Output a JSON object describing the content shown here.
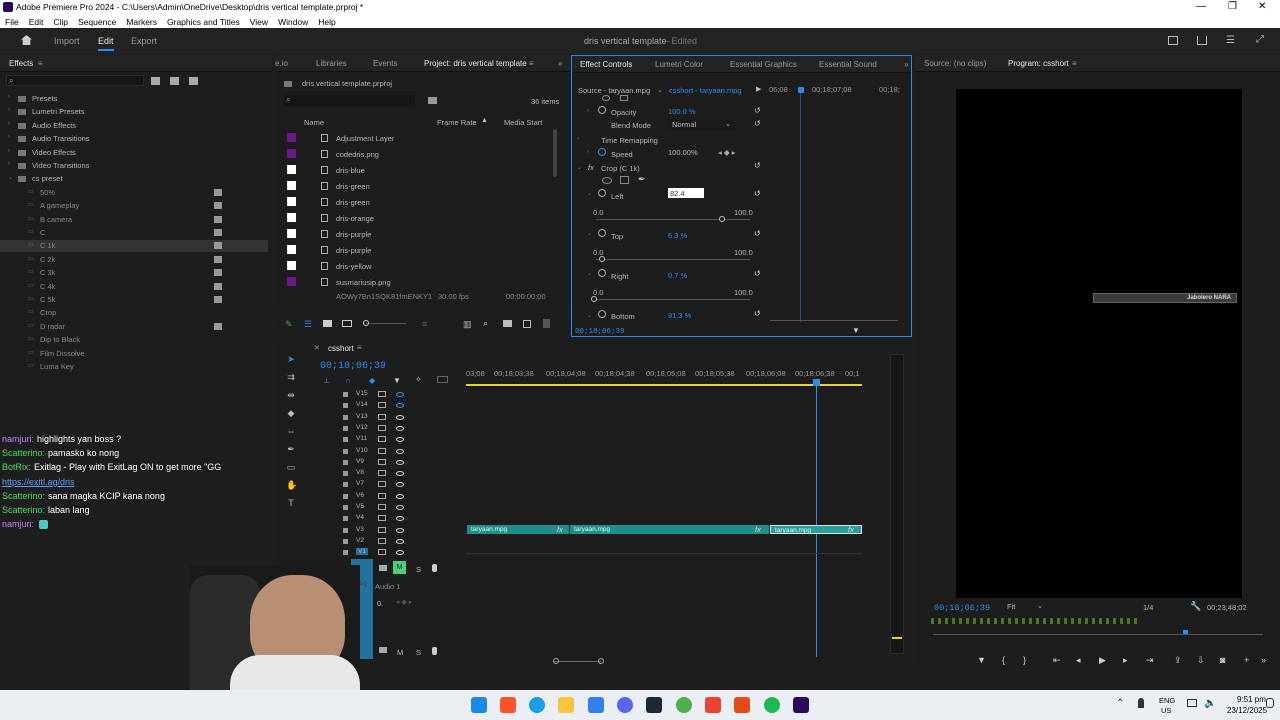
{
  "app": {
    "title": "Adobe Premiere Pro 2024 - C:\\Users\\Admin\\OneDrive\\Desktop\\dris vertical template.prproj *",
    "window_controls": [
      "—",
      "❐",
      "✕"
    ]
  },
  "menu": [
    "File",
    "Edit",
    "Clip",
    "Sequence",
    "Markers",
    "Graphics and Titles",
    "View",
    "Window",
    "Help"
  ],
  "workspaces": {
    "import": "Import",
    "edit": "Edit",
    "export": "Export",
    "project_title": "dris vertical template",
    "edited": "- Edited"
  },
  "effects_panel": {
    "title": "Effects",
    "items": [
      {
        "label": "Presets",
        "indent": 0
      },
      {
        "label": "Lumetri Presets",
        "indent": 0
      },
      {
        "label": "Audio Effects",
        "indent": 0
      },
      {
        "label": "Audio Transitions",
        "indent": 0
      },
      {
        "label": "Video Effects",
        "indent": 0
      },
      {
        "label": "Video Transitions",
        "indent": 0
      },
      {
        "label": "cs preset",
        "indent": 0
      },
      {
        "label": "50%",
        "indent": 1
      },
      {
        "label": "A gameplay",
        "indent": 1
      },
      {
        "label": "B camera",
        "indent": 1
      },
      {
        "label": "C",
        "indent": 1
      },
      {
        "label": "C 1k",
        "indent": 1
      },
      {
        "label": "C 2k",
        "indent": 1
      },
      {
        "label": "C 3k",
        "indent": 1
      },
      {
        "label": "C 4k",
        "indent": 1
      },
      {
        "label": "C 5k",
        "indent": 1
      },
      {
        "label": "Crop",
        "indent": 1
      },
      {
        "label": "D radar",
        "indent": 1
      },
      {
        "label": "Dip to Black",
        "indent": 1
      },
      {
        "label": "Film Dissolve",
        "indent": 1
      },
      {
        "label": "Luma Key",
        "indent": 1
      }
    ]
  },
  "project_panel": {
    "tabs": [
      "e.io",
      "Libraries",
      "Events",
      "Project: dris vertical template"
    ],
    "file": "dris vertical template.prproj",
    "item_count": "36 items",
    "col_name": "Name",
    "col_rate": "Frame Rate",
    "col_start": "Media Start",
    "items": [
      {
        "name": "Adjustment Layer",
        "color": "#6a1b8a"
      },
      {
        "name": "codedris.png",
        "color": "#6a1b8a"
      },
      {
        "name": "dris-blue",
        "color": "#ffffff"
      },
      {
        "name": "dris-green",
        "color": "#ffffff"
      },
      {
        "name": "dris-green",
        "color": "#ffffff"
      },
      {
        "name": "dris-orange",
        "color": "#ffffff"
      },
      {
        "name": "dris-purple",
        "color": "#ffffff"
      },
      {
        "name": "dris-purple",
        "color": "#ffffff"
      },
      {
        "name": "dris-yellow",
        "color": "#ffffff"
      },
      {
        "name": "susmariusip.png",
        "color": "#6a1b8a"
      }
    ],
    "partial_row": {
      "name": "AOWy7Bn1SQK81fmENKY1",
      "rate": "30.00 fps",
      "start": "00:00:00:00"
    }
  },
  "effect_controls": {
    "tabs": [
      "Effect Controls",
      "Lumetri Color",
      "Essential Graphics",
      "Essential Sound"
    ],
    "source": "Source - taryaan.mpg",
    "sequence": "csshort - taryaan.mpg",
    "ruler": [
      "06;08",
      "00;18;07;08",
      "00;18;"
    ],
    "opacity_label": "Opacity",
    "opacity_value": "100.0 %",
    "blend_label": "Blend Mode",
    "blend_value": "Normal",
    "time_remap": "Time Remapping",
    "speed_label": "Speed",
    "speed_value": "100.00%",
    "crop_label": "Crop (C 1k)",
    "left_label": "Left",
    "left_value": "82.4",
    "top_label": "Top",
    "top_value": "6.3 %",
    "right_label": "Right",
    "right_value": "0.7 %",
    "bottom_label": "Bottom",
    "bottom_value": "91.3 %",
    "range_min": "0.0",
    "range_max": "100.0",
    "timecode": "00;18;06;39"
  },
  "program_monitor": {
    "source_tab": "Source: (no clips)",
    "program_tab": "Program: csshort",
    "timecode": "00;18;06;39",
    "fit": "Fit",
    "quality": "1/4",
    "duration": "00;23;48;02",
    "overlay_text": "Jabolero NARA"
  },
  "timeline": {
    "sequence": "csshort",
    "timecode": "00;18;06;39",
    "ruler": [
      "03;08",
      "00;18;03;38",
      "00;18;04;08",
      "00;18;04;38",
      "00;18;05;08",
      "00;18;05;38",
      "00;18;06;08",
      "00;18;06;38",
      "00;1"
    ],
    "video_tracks": [
      "V15",
      "V14",
      "V13",
      "V12",
      "V11",
      "V10",
      "V9",
      "V8",
      "V7",
      "V6",
      "V5",
      "V4",
      "V3",
      "V2",
      "V1"
    ],
    "audio_track": "A1",
    "audio_name": "Audio 1",
    "audio_level": "0.",
    "m_label": "M",
    "s_label": "S",
    "clips": [
      "taryaan.mpg",
      "taryaan.mpg",
      "taryaan.mpg"
    ],
    "fx": "fx"
  },
  "chat": [
    {
      "user": "namjuri:",
      "text": "highlights yan boss ?",
      "color": "#c77dff"
    },
    {
      "user": "Scatterino:",
      "text": "pamasko ko nong",
      "color": "#4cd964"
    },
    {
      "user": "BotRix:",
      "text": "Exitlag - Play with ExitLag ON to get more \"GG",
      "color": "#4cd964"
    },
    {
      "user": "",
      "text": "https://exitl.ag/dris",
      "color": "#5aa0ff"
    },
    {
      "user": "Scatterino:",
      "text": "sana magka KCIP kana nong",
      "color": "#4cd964"
    },
    {
      "user": "Scatterino:",
      "text": "laban lang",
      "color": "#4cd964"
    },
    {
      "user": "namjuri:",
      "text": "",
      "color": "#c77dff"
    }
  ],
  "taskbar": {
    "lang": "ENG",
    "region": "US",
    "time": "9:51 pm",
    "date": "23/12/2025"
  }
}
